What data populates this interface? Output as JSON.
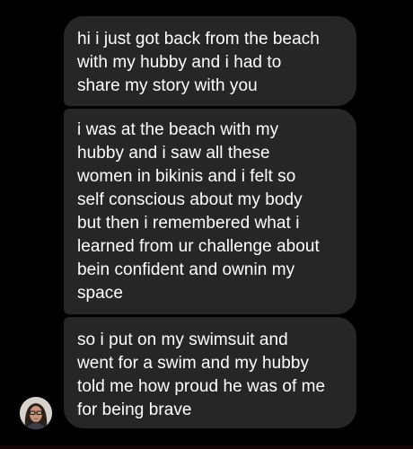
{
  "conversation": {
    "messages": [
      {
        "text": "hi i just got back from the beach\nwith my hubby and i had to\nshare my story with you"
      },
      {
        "text": "i was at the beach with my\nhubby and i saw all these\nwomen in bikinis and i felt so\nself conscious about my body\nbut then i remembered what i\nlearned from ur challenge about\nbein confident and ownin my\nspace"
      },
      {
        "text": "so i put on my swimsuit and\nwent for a swim and my hubby\ntold me how proud he was of me\nfor being brave"
      }
    ],
    "sender_avatar_icon": "user-avatar-photo"
  },
  "colors": {
    "background": "#000000",
    "bubble": "#262626",
    "text": "#ffffff"
  }
}
